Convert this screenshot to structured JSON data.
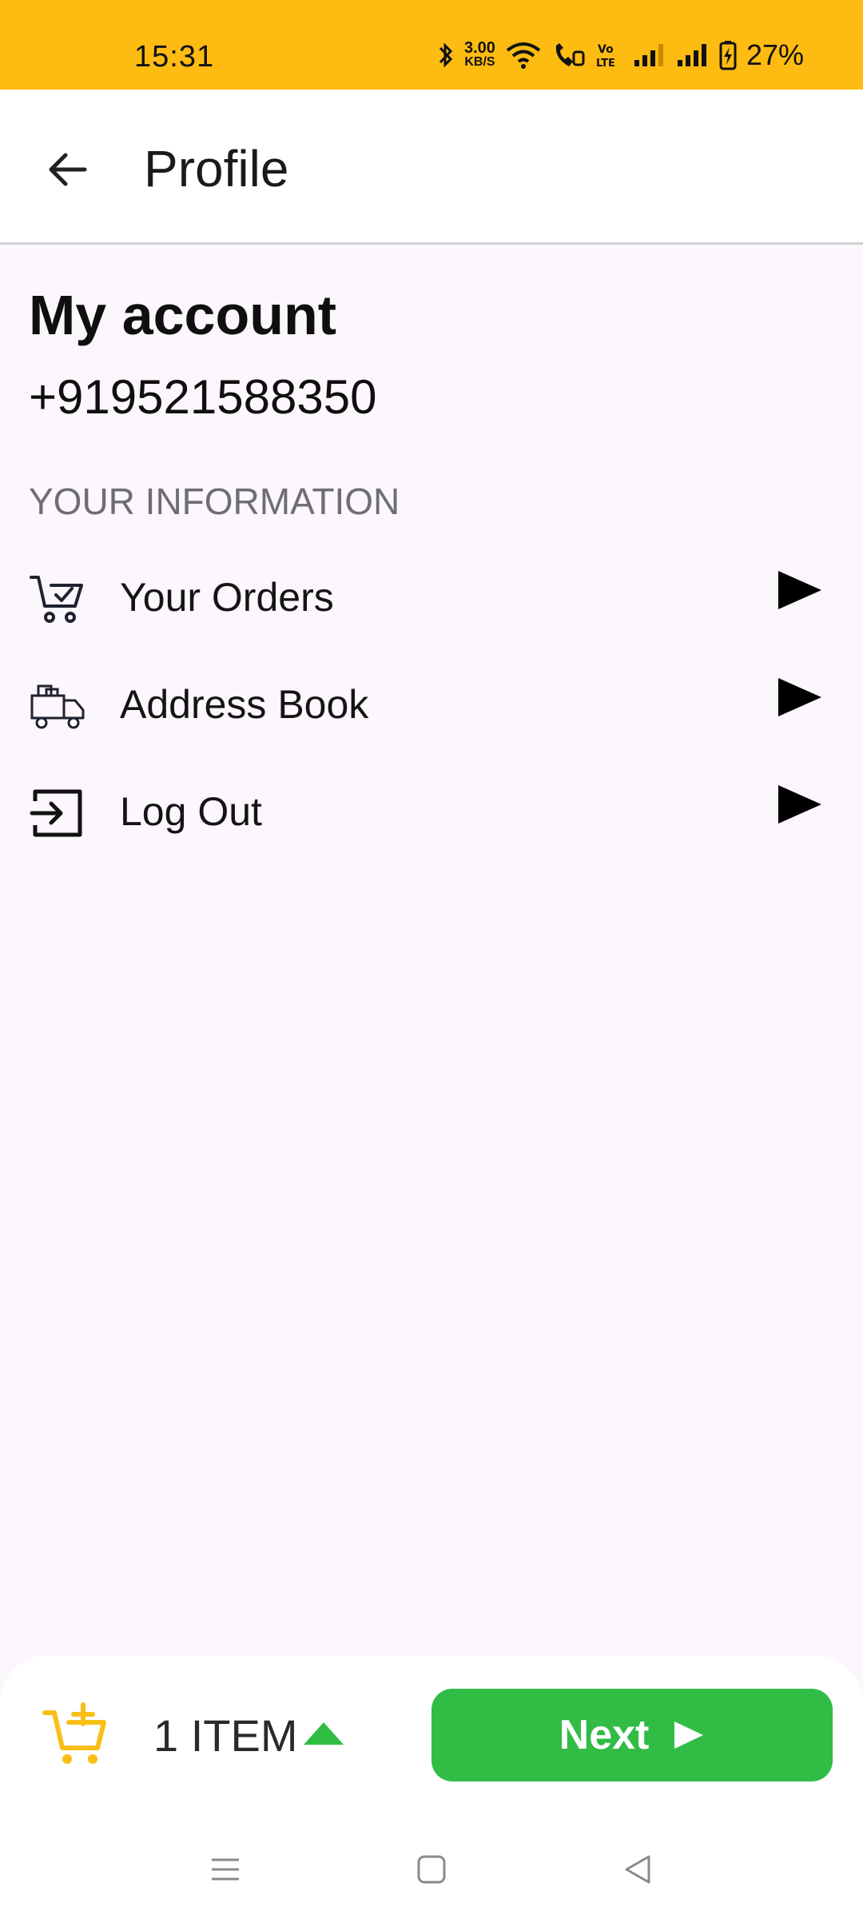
{
  "status_bar": {
    "time": "15:31",
    "network_speed_value": "3.00",
    "network_speed_unit": "KB/S",
    "battery_percent": "27%",
    "icons": [
      "bluetooth-icon",
      "wifi-icon",
      "wifi-call-icon",
      "volte-icon",
      "signal-icon",
      "signal-icon",
      "battery-charging-icon"
    ]
  },
  "app_bar": {
    "back_icon": "arrow-left-icon",
    "title": "Profile"
  },
  "account": {
    "heading": "My account",
    "phone": "+919521588350"
  },
  "section": {
    "label": "YOUR INFORMATION"
  },
  "menu": {
    "items": [
      {
        "label": "Your Orders",
        "icon": "cart-check-icon"
      },
      {
        "label": "Address Book",
        "icon": "delivery-truck-icon"
      },
      {
        "label": "Log Out",
        "icon": "logout-icon"
      }
    ]
  },
  "cart_bar": {
    "item_count": "1 ITEM",
    "next_label": "Next",
    "colors": {
      "cart_icon": "#F9BE17",
      "next_button": "#31BC45",
      "caret": "#31BC45"
    }
  },
  "theme": {
    "status_bar_bg": "#FEBB12",
    "page_bg": "#FCF6FD"
  },
  "nav_bar": {
    "buttons": [
      "menu-icon",
      "home-icon",
      "back-icon"
    ]
  }
}
